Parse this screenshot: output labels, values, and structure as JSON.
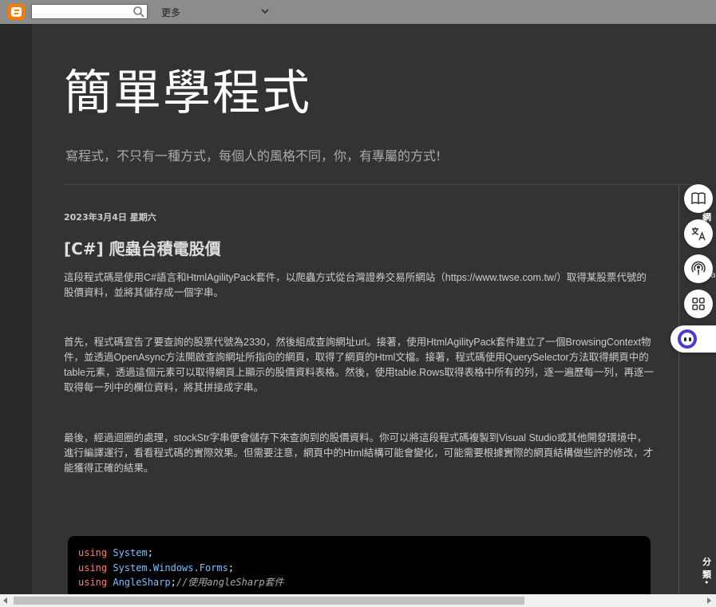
{
  "navbar": {
    "logo_icon": "blogger-logo-icon",
    "search_placeholder": "",
    "more_label": "更多"
  },
  "header": {
    "title": "簡單學程式",
    "description": "寫程式，不只有一種方式，每個人的風格不同，你，有專屬的方式!"
  },
  "post": {
    "date": "2023年3月4日 星期六",
    "title": "[C#] 爬蟲台積電股價",
    "paragraphs": [
      " 這段程式碼是使用C#語言和HtmlAgilityPack套件，以爬蟲方式從台灣證券交易所網站（https://www.twse.com.tw/）取得某股票代號的股價資料，並將其儲存成一個字串。",
      "首先，程式碼宣告了要查詢的股票代號為2330，然後組成查詢網址url。接著，使用HtmlAgilityPack套件建立了一個BrowsingContext物件，並透過OpenAsync方法開啟查詢網址所指向的網頁，取得了網頁的Html文檔。接著，程式碼使用QuerySelector方法取得網頁中的table元素，透過這個元素可以取得網頁上顯示的股價資料表格。然後，使用table.Rows取得表格中所有的列，逐一遍歷每一列，再逐一取得每一列中的欄位資料，將其拼接成字串。",
      "最後，經過迴圈的處理，stockStr字串便會儲存下來查詢到的股價資料。你可以將這段程式碼複製到Visual Studio或其他開發環境中，進行編譯運行，看看程式碼的實際效果。但需要注意，網頁中的Html結構可能會變化，可能需要根據實際的網頁結構做些許的修改，才能獲得正確的結果。"
    ],
    "code": [
      {
        "kw": "using",
        "ns": "System",
        "rest": ";",
        "comment": ""
      },
      {
        "kw": "using",
        "ns": "System.Windows.Forms",
        "rest": ";",
        "comment": ""
      },
      {
        "kw": "using",
        "ns": "AngleSharp",
        "rest": ";",
        "comment": "//使用angleSharp套件"
      }
    ]
  },
  "sidebar": {
    "label_top": "網頁",
    "label_a": "a",
    "label_bottom": "分類",
    "bullet": "•"
  },
  "colors": {
    "navbar": "#8c8c8c",
    "page_bg": "#333333",
    "outer_bg": "#292929",
    "accent": "#f57d00"
  }
}
